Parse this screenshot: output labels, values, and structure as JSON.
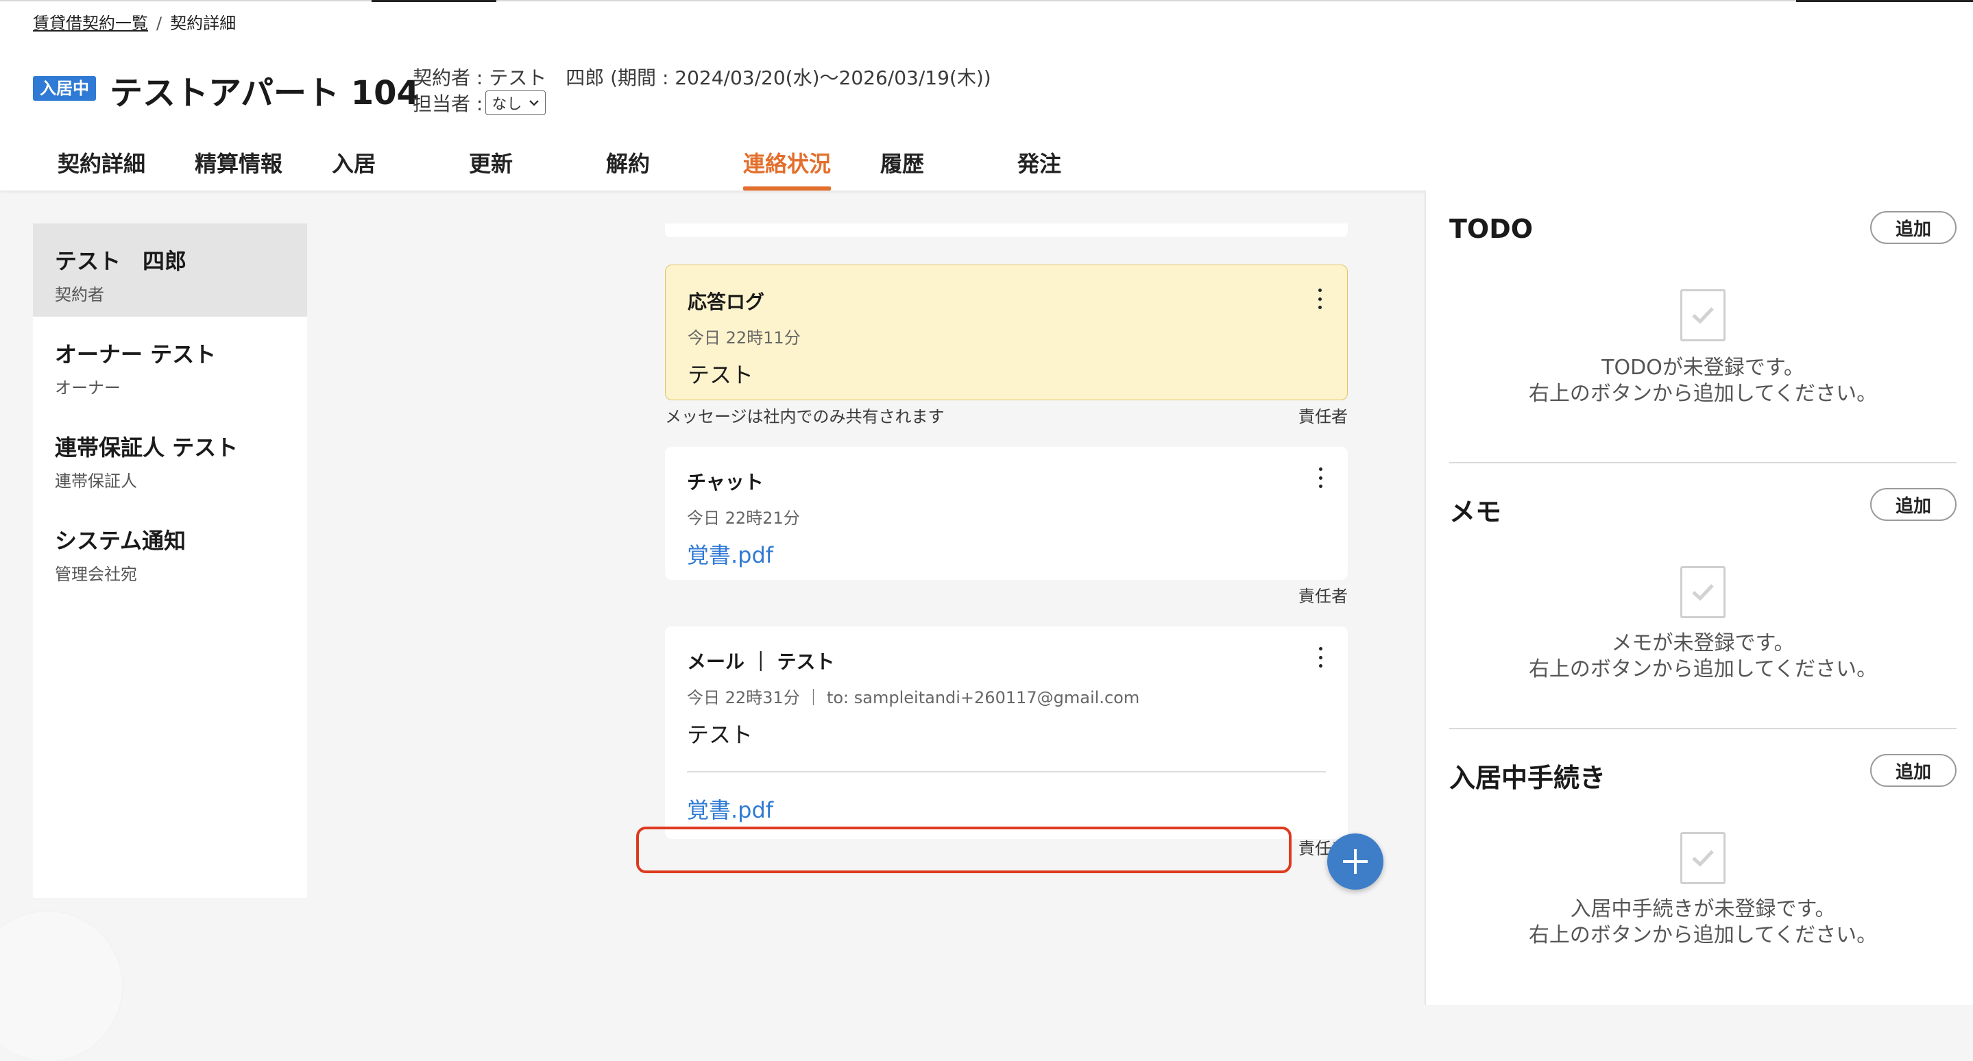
{
  "breadcrumb": {
    "parent": "賃貸借契約一覧",
    "separator": "/",
    "current": "契約詳細"
  },
  "header": {
    "status_badge": "入居中",
    "property_title": "テストアパート 104",
    "contract_info": "契約者 : テスト　四郎 (期間 : 2024/03/20(水)〜2026/03/19(木))",
    "assignee_label": "担当者 :",
    "assignee_value": "なし"
  },
  "tabs": [
    {
      "label": "契約詳細",
      "active": false
    },
    {
      "label": "精算情報",
      "active": false
    },
    {
      "label": "入居",
      "active": false
    },
    {
      "label": "更新",
      "active": false
    },
    {
      "label": "解約",
      "active": false
    },
    {
      "label": "連絡状況",
      "active": true
    },
    {
      "label": "履歴",
      "active": false
    },
    {
      "label": "発注",
      "active": false
    }
  ],
  "sidebar": {
    "items": [
      {
        "name": "テスト　四郎",
        "role": "契約者",
        "selected": true
      },
      {
        "name": "オーナー テスト",
        "role": "オーナー",
        "selected": false
      },
      {
        "name": "連帯保証人 テスト",
        "role": "連帯保証人",
        "selected": false
      },
      {
        "name": "システム通知",
        "role": "管理会社宛",
        "selected": false
      }
    ]
  },
  "feed": {
    "messages": [
      {
        "title": "応答ログ",
        "meta": "今日 22時11分",
        "body": "テスト",
        "note_left": "メッセージは社内でのみ共有されます",
        "note_right": "責任者"
      },
      {
        "title": "チャット",
        "meta": "今日 22時21分",
        "attachment": "覚書.pdf",
        "note_right": "責任者"
      },
      {
        "title": "メール ｜ テスト",
        "meta": "今日 22時31分 ｜ to: sampleitandi+260117@gmail.com",
        "body": "テスト",
        "attachment": "覚書.pdf",
        "note_right": "責任者"
      }
    ]
  },
  "right_panel": {
    "sections": [
      {
        "title": "TODO",
        "add_label": "追加",
        "empty_line1": "TODOが未登録です。",
        "empty_line2": "右上のボタンから追加してください。"
      },
      {
        "title": "メモ",
        "add_label": "追加",
        "empty_line1": "メモが未登録です。",
        "empty_line2": "右上のボタンから追加してください。"
      },
      {
        "title": "入居中手続き",
        "add_label": "追加",
        "empty_line1": "入居中手続きが未登録です。",
        "empty_line2": "右上のボタンから追加してください。"
      }
    ]
  },
  "colors": {
    "accent": "#e36f2c",
    "primary": "#2f7ad4",
    "log_bg": "#fdf3cd",
    "highlight": "#dd3b1e"
  },
  "icons": [
    "chevron-down-icon",
    "more-vert-icon",
    "plus-icon",
    "checkbox-icon"
  ]
}
